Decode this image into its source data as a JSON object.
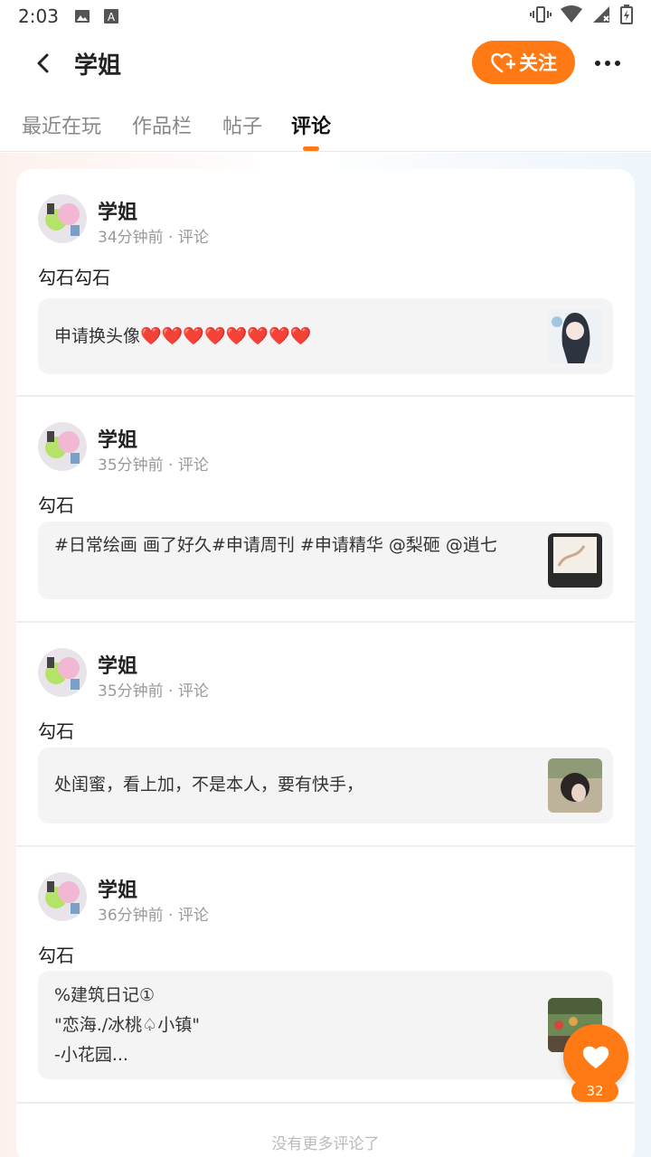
{
  "status": {
    "time": "2:03"
  },
  "header": {
    "title": "学姐",
    "follow_label": "关注"
  },
  "tabs": [
    {
      "label": "最近在玩"
    },
    {
      "label": "作品栏"
    },
    {
      "label": "帖子"
    },
    {
      "label": "评论"
    }
  ],
  "comments": [
    {
      "user": "学姐",
      "meta": "34分钟前 · 评论",
      "text": "勾石勾石",
      "quote": "申请换头像❤️❤️❤️❤️❤️❤️❤️❤️"
    },
    {
      "user": "学姐",
      "meta": "35分钟前 · 评论",
      "text": "勾石",
      "quote": "#日常绘画   画了好久#申请周刊   #申请精华 @梨砸  @逍七"
    },
    {
      "user": "学姐",
      "meta": "35分钟前 · 评论",
      "text": "勾石",
      "quote": "处闺蜜，看上加，不是本人，要有快手，"
    },
    {
      "user": "学姐",
      "meta": "36分钟前 · 评论",
      "text": "勾石",
      "quote": "%建筑日记①\n\"恋海./冰桃♤小镇\"\n-小花园..."
    }
  ],
  "footer": {
    "no_more": "没有更多评论了"
  },
  "like": {
    "count": "32"
  },
  "colors": {
    "accent": "#ff7a14"
  }
}
